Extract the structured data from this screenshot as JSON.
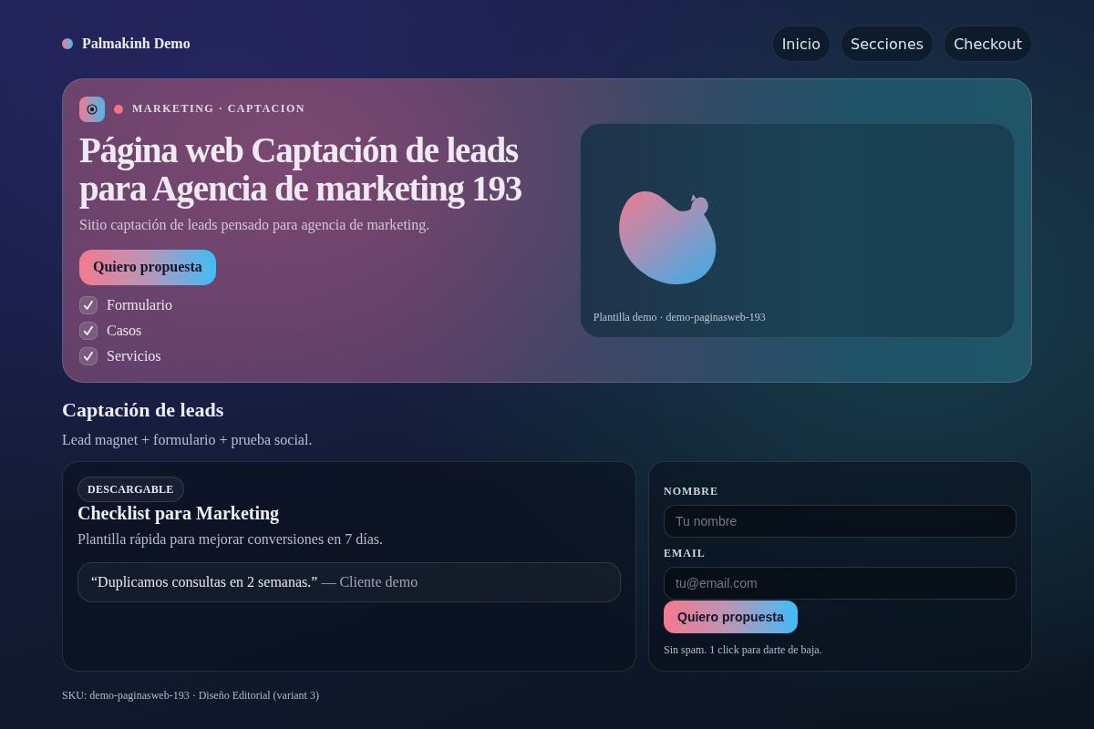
{
  "brand": {
    "name": "Palmakinh Demo"
  },
  "nav": [
    {
      "label": "Inicio"
    },
    {
      "label": "Secciones"
    },
    {
      "label": "Checkout"
    }
  ],
  "hero": {
    "eyebrow": "MARKETING · CAPTACION",
    "title": "Página web Captación de leads para Agencia de marketing 193",
    "subtitle": "Sitio captación de leads pensado para agencia de marketing.",
    "cta": "Quiero propuesta",
    "features": [
      {
        "label": "Formulario",
        "checked": true
      },
      {
        "label": "Casos",
        "checked": true
      },
      {
        "label": "Servicios",
        "checked": true
      }
    ],
    "preview": {
      "caption": "Plantilla demo · demo-paginasweb-193"
    }
  },
  "section": {
    "title": "Captación de leads",
    "subtitle": "Lead magnet + formulario + prueba social."
  },
  "lead_magnet": {
    "badge": "DESCARGABLE",
    "title": "Checklist para Marketing",
    "description": "Plantilla rápida para mejorar conversiones en 7 días.",
    "testimonial": {
      "quote": "“Duplicamos consultas en 2 semanas.”",
      "author": "— Cliente demo"
    }
  },
  "form": {
    "fields": [
      {
        "label": "NOMBRE",
        "placeholder": "Tu nombre"
      },
      {
        "label": "EMAIL",
        "placeholder": "tu@email.com"
      }
    ],
    "submit": "Quiero propuesta",
    "note": "Sin spam. 1 click para darte de baja."
  },
  "footer": {
    "text": "SKU: demo-paginasweb-193 · Diseño Editorial (variant 3)"
  }
}
